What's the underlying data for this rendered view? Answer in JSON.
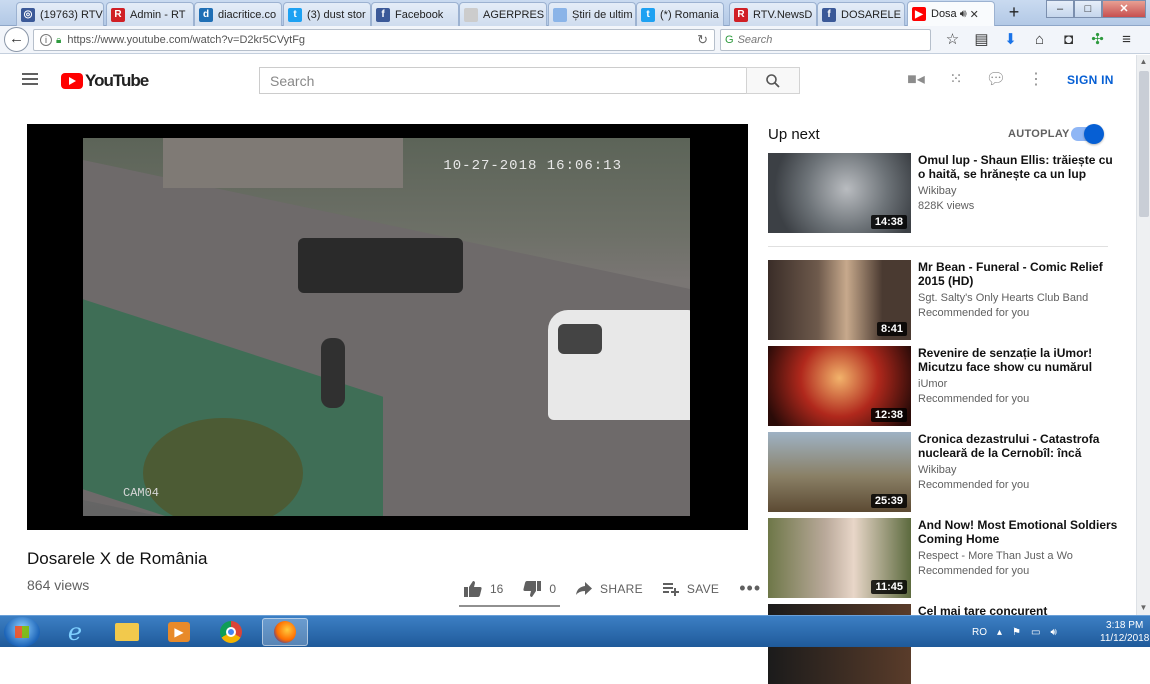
{
  "browser": {
    "tabs": [
      {
        "label": "(19763) RTV",
        "icon": "globe-icon",
        "color": "#3b5998",
        "glyph": "◎"
      },
      {
        "label": "Admin - RT",
        "icon": "rtv-icon",
        "color": "#d01f25",
        "glyph": "R"
      },
      {
        "label": "diacritice.co",
        "icon": "d-icon",
        "color": "#1f6fb5",
        "glyph": "d"
      },
      {
        "label": "(3) dust stor",
        "icon": "twitter-icon",
        "color": "#1da1f2",
        "glyph": "t"
      },
      {
        "label": "Facebook",
        "icon": "facebook-icon",
        "color": "#3b5998",
        "glyph": "f"
      },
      {
        "label": "AGERPRES -",
        "icon": "page-icon",
        "color": "#cccccc",
        "glyph": ""
      },
      {
        "label": "Știri de ultim",
        "icon": "page-icon",
        "color": "#8ab4e8",
        "glyph": ""
      },
      {
        "label": "(*) Romania",
        "icon": "twitter-icon",
        "color": "#1da1f2",
        "glyph": "t"
      },
      {
        "label": "RTV.NewsD",
        "icon": "rtv-icon",
        "color": "#d01f25",
        "glyph": "R"
      },
      {
        "label": "DOSARELE",
        "icon": "facebook-icon",
        "color": "#3b5998",
        "glyph": "f"
      },
      {
        "label": "Dosa",
        "icon": "youtube-icon",
        "color": "#ff0000",
        "glyph": "▶",
        "active": true
      }
    ],
    "url": "https://www.youtube.com/watch?v=D2kr5CVytFg",
    "search_placeholder": "Search"
  },
  "youtube": {
    "logo": "YouTube",
    "search_placeholder": "Search",
    "sign_in": "SIGN IN"
  },
  "player": {
    "timestamp": "10-27-2018 16:06:13",
    "camera": "CAM04"
  },
  "video": {
    "title": "Dosarele X de România",
    "views": "864 views",
    "likes": "16",
    "dislikes": "0",
    "share_label": "SHARE",
    "save_label": "SAVE"
  },
  "sidebar": {
    "up_next": "Up next",
    "autoplay": "AUTOPLAY",
    "videos": [
      {
        "title": "Omul lup - Shaun Ellis: trăiește cu o haită, se hrănește ca un lup",
        "channel": "Wikibay",
        "meta": "828K views",
        "duration": "14:38"
      },
      {
        "title": "Mr Bean - Funeral - Comic Relief 2015 (HD)",
        "channel": "Sgt. Salty's Only Hearts Club Band",
        "meta": "Recommended for you",
        "duration": "8:41"
      },
      {
        "title": "Revenire de senzație la iUmor! Micutzu face show cu numărul",
        "channel": "iUmor",
        "meta": "Recommended for you",
        "duration": "12:38"
      },
      {
        "title": "Cronica dezastrului - Catastrofa nucleară de la Cernobîl: încă",
        "channel": "Wikibay",
        "meta": "Recommended for you",
        "duration": "25:39"
      },
      {
        "title": "And Now! Most Emotional Soldiers Coming Home",
        "channel": "Respect - More Than Just a Wo",
        "meta": "Recommended for you",
        "duration": "11:45"
      },
      {
        "title": "Cel mai tare concurent",
        "channel": "",
        "meta": "",
        "duration": ""
      }
    ]
  },
  "taskbar": {
    "language": "RO",
    "time": "3:18 PM",
    "date": "11/12/2018"
  }
}
